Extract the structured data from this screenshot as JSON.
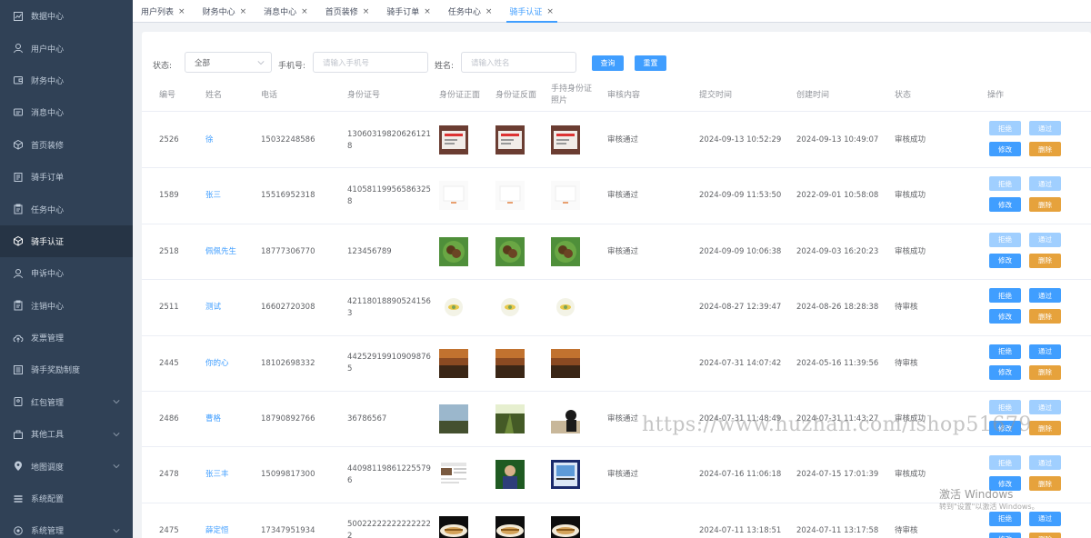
{
  "sidebar": {
    "items": [
      {
        "label": "数据中心",
        "icon": "chart-icon",
        "active": false
      },
      {
        "label": "用户中心",
        "icon": "user-icon",
        "active": false
      },
      {
        "label": "财务中心",
        "icon": "wallet-icon",
        "active": false
      },
      {
        "label": "消息中心",
        "icon": "message-icon",
        "active": false
      },
      {
        "label": "首页装修",
        "icon": "cube-icon",
        "active": false
      },
      {
        "label": "骑手订单",
        "icon": "document-icon",
        "active": false
      },
      {
        "label": "任务中心",
        "icon": "clipboard-icon",
        "active": false
      },
      {
        "label": "骑手认证",
        "icon": "cube-icon",
        "active": true
      },
      {
        "label": "申诉中心",
        "icon": "user-icon",
        "active": false
      },
      {
        "label": "注销中心",
        "icon": "clipboard-icon",
        "active": false
      },
      {
        "label": "发票管理",
        "icon": "cloud-upload-icon",
        "active": false
      },
      {
        "label": "骑手奖励制度",
        "icon": "list-icon",
        "active": false
      },
      {
        "label": "红包管理",
        "icon": "redpacket-icon",
        "active": false,
        "expandable": true
      },
      {
        "label": "其他工具",
        "icon": "toolbox-icon",
        "active": false,
        "expandable": true
      },
      {
        "label": "地图调度",
        "icon": "location-icon",
        "active": false,
        "expandable": true
      },
      {
        "label": "系统配置",
        "icon": "settings-list-icon",
        "active": false
      },
      {
        "label": "系统管理",
        "icon": "gear-icon",
        "active": false,
        "expandable": true
      }
    ]
  },
  "tabs": [
    {
      "label": "用户列表",
      "active": false
    },
    {
      "label": "财务中心",
      "active": false
    },
    {
      "label": "消息中心",
      "active": false
    },
    {
      "label": "首页装修",
      "active": false
    },
    {
      "label": "骑手订单",
      "active": false
    },
    {
      "label": "任务中心",
      "active": false
    },
    {
      "label": "骑手认证",
      "active": true
    }
  ],
  "tab_close_glyph": "×",
  "filters": {
    "status_label": "状态:",
    "status_value": "全部",
    "phone_label": "手机号:",
    "phone_placeholder": "请输入手机号",
    "name_label": "姓名:",
    "name_placeholder": "请输入姓名",
    "query_button": "查询",
    "reset_button": "重置"
  },
  "table": {
    "headers": [
      "编号",
      "姓名",
      "电话",
      "身份证号",
      "身份证正面",
      "身份证反面",
      "手持身份证照片",
      "审核内容",
      "提交时间",
      "创建时间",
      "状态",
      "操作"
    ],
    "rows": [
      {
        "id": "2526",
        "name": "徐",
        "phone": "15032248586",
        "idcard": "130603198206261218",
        "review": "审核通过",
        "submit": "2024-09-13 10:52:29",
        "created": "2024-09-13 10:49:07",
        "status": "审核成功",
        "photos": [
          "id-red",
          "id-red",
          "id-red"
        ],
        "actions_enabled": false
      },
      {
        "id": "1589",
        "name": "张三",
        "phone": "15516952318",
        "idcard": "410581199565863258",
        "review": "审核通过",
        "submit": "2024-09-09 11:53:50",
        "created": "2022-09-01 10:58:08",
        "status": "审核成功",
        "photos": [
          "doc-white",
          "doc-white",
          "doc-white"
        ],
        "actions_enabled": false
      },
      {
        "id": "2518",
        "name": "佩佩先生",
        "phone": "18777306770",
        "idcard": "123456789",
        "review": "审核通过",
        "submit": "2024-09-09 10:06:38",
        "created": "2024-09-03 16:20:23",
        "status": "审核成功",
        "photos": [
          "food-green",
          "food-green",
          "food-green"
        ],
        "actions_enabled": false
      },
      {
        "id": "2511",
        "name": "测试",
        "phone": "16602720308",
        "idcard": "421180188905241563",
        "review": "",
        "submit": "2024-08-27 12:39:47",
        "created": "2024-08-26 18:28:38",
        "status": "待审核",
        "photos": [
          "badge-circle",
          "badge-circle",
          "badge-circle"
        ],
        "actions_enabled": true
      },
      {
        "id": "2445",
        "name": "你的心",
        "phone": "18102698332",
        "idcard": "442529199109098765",
        "review": "",
        "submit": "2024-07-31 14:07:42",
        "created": "2024-05-16 11:39:56",
        "status": "待审核",
        "photos": [
          "sunset",
          "sunset",
          "sunset"
        ],
        "actions_enabled": true
      },
      {
        "id": "2486",
        "name": "曹格",
        "phone": "18790892766",
        "idcard": "36786567",
        "review": "审核通过",
        "submit": "2024-07-31 11:48:49",
        "created": "2024-07-31 11:43:27",
        "status": "审核成功",
        "photos": [
          "landscape",
          "field",
          "person"
        ],
        "actions_enabled": false
      },
      {
        "id": "2478",
        "name": "张三丰",
        "phone": "15099817300",
        "idcard": "440981198612255796",
        "review": "审核通过",
        "submit": "2024-07-16 11:06:18",
        "created": "2024-07-15 17:01:39",
        "status": "审核成功",
        "photos": [
          "screenshot",
          "portrait",
          "poster"
        ],
        "actions_enabled": false
      },
      {
        "id": "2475",
        "name": "薛定恒",
        "phone": "17347951934",
        "idcard": "500222222222222222",
        "review": "",
        "submit": "2024-07-11 13:18:51",
        "created": "2024-07-11 13:17:58",
        "status": "待审核",
        "photos": [
          "dish-dark",
          "dish-dark",
          "dish-dark"
        ],
        "actions_enabled": true
      }
    ],
    "action_labels": {
      "reject": "拒绝",
      "approve": "通过",
      "edit": "修改",
      "delete": "删除"
    }
  },
  "overlay": {
    "watermark": "https://www.huzhan.com/ishop51679",
    "windows_activate": "激活 Windows",
    "windows_activate_sub": "转到\"设置\"以激活 Windows。"
  },
  "colors": {
    "sidebar_bg": "#304156",
    "sidebar_active_bg": "#263445",
    "primary": "#409eff",
    "primary_disabled": "#a0cfff",
    "warning": "#e6a23c"
  }
}
